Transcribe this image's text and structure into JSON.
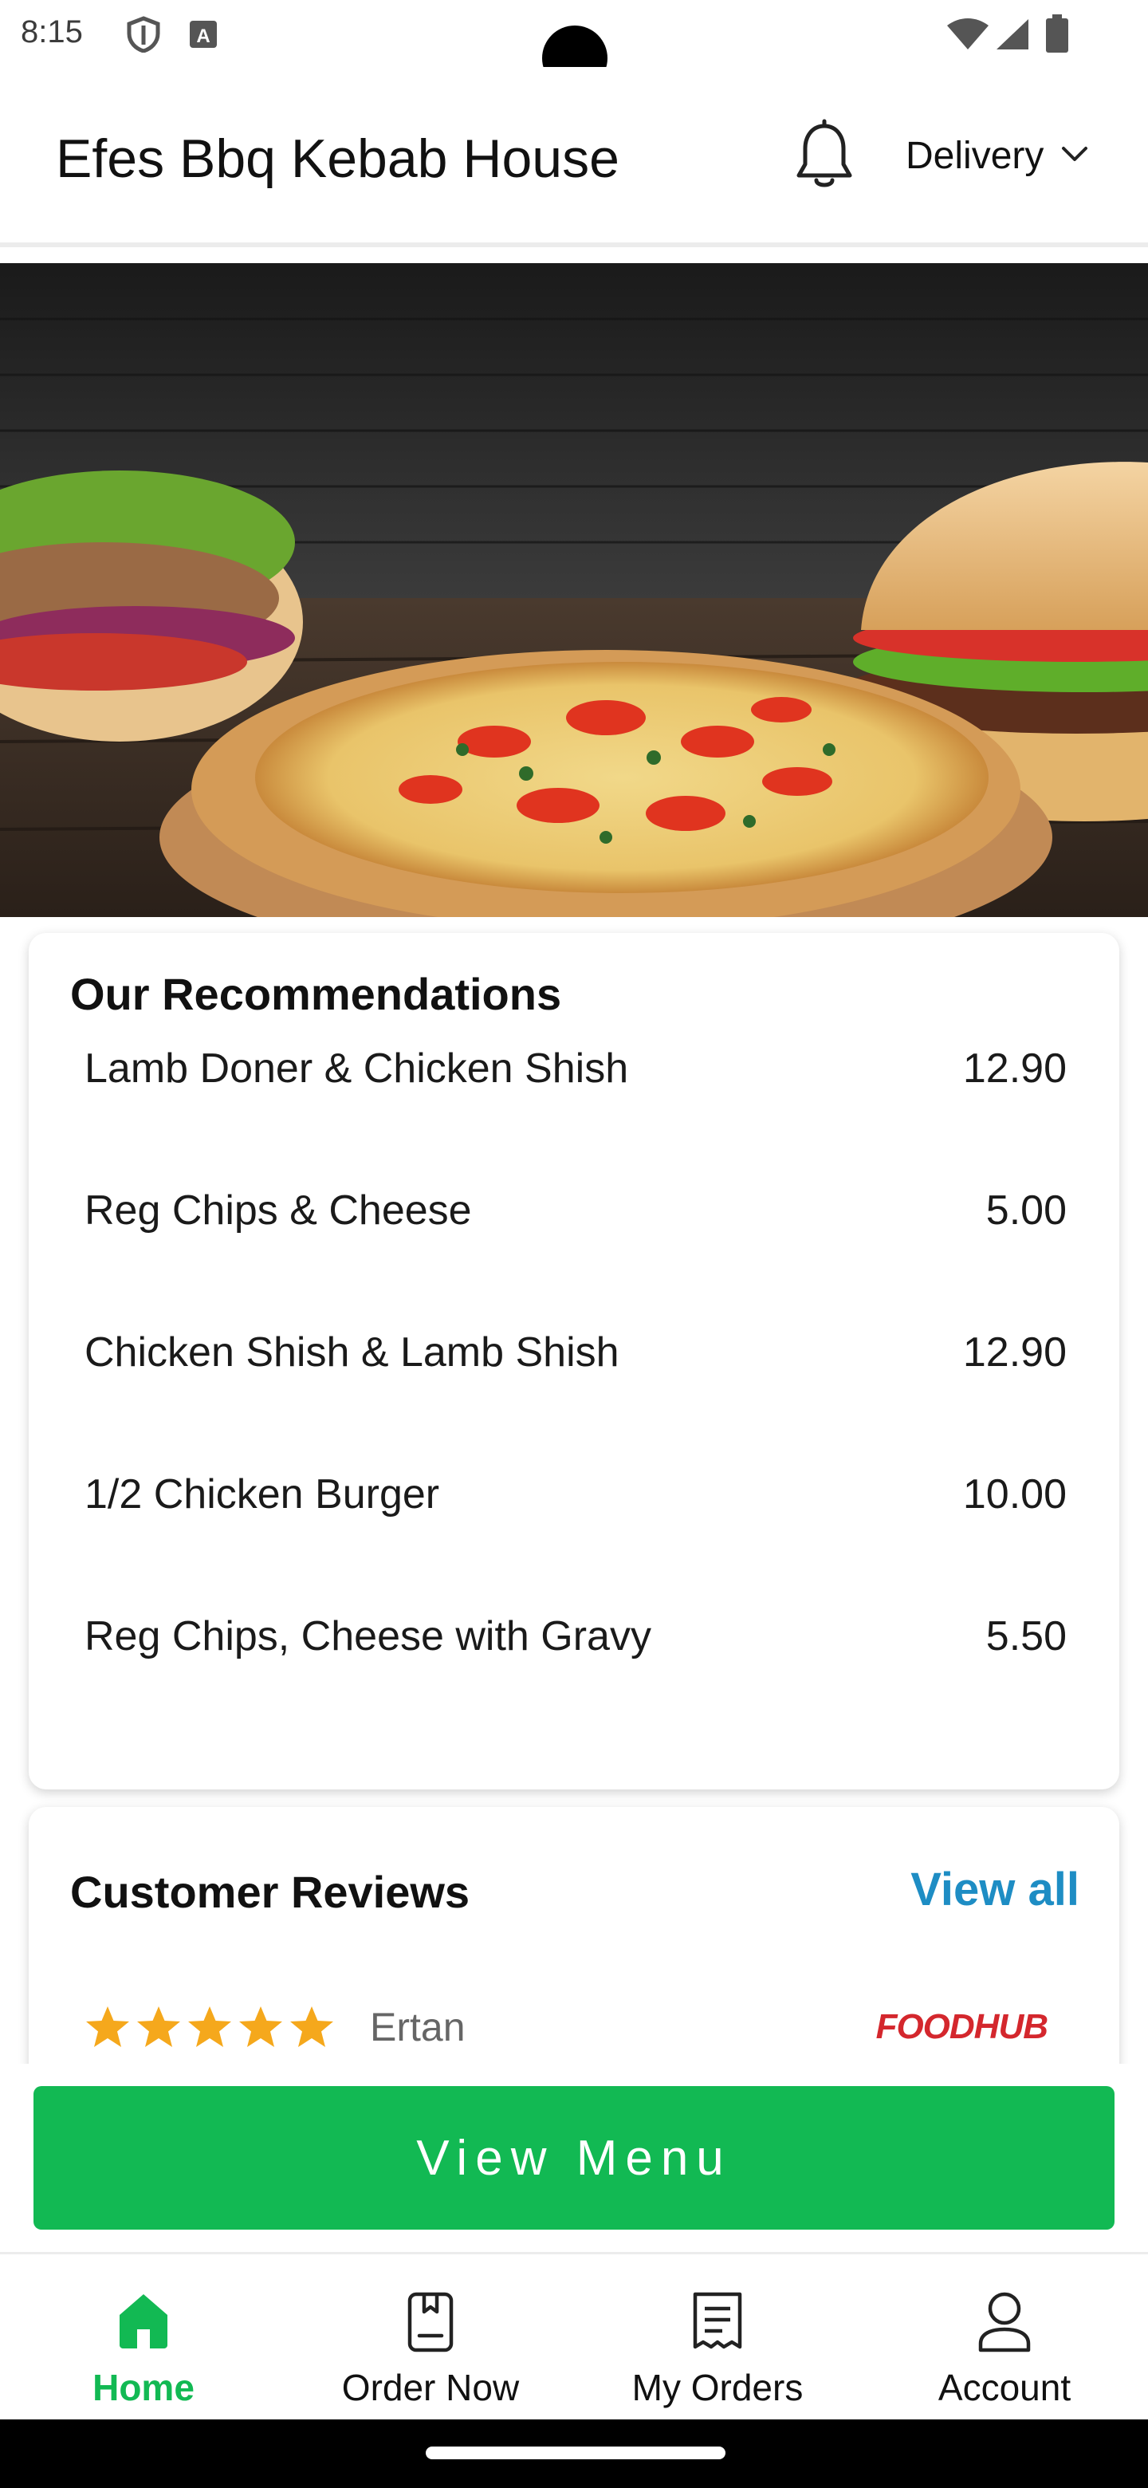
{
  "status_bar": {
    "time": "8:15",
    "icons": [
      "shield-icon",
      "text-a-icon",
      "wifi-icon",
      "signal-icon",
      "battery-icon"
    ]
  },
  "header": {
    "store_name": "Efes Bbq Kebab House",
    "notification_icon": "bell-icon",
    "order_mode": "Delivery"
  },
  "hero": {
    "image": "food-banner: doner kebab, pizza, burger on dark wood"
  },
  "recommendations": {
    "title": "Our Recommendations",
    "items": [
      {
        "name": "Lamb Doner & Chicken Shish",
        "price": "12.90"
      },
      {
        "name": "Reg Chips & Cheese",
        "price": "5.00"
      },
      {
        "name": "Chicken Shish & Lamb Shish",
        "price": "12.90"
      },
      {
        "name": "1/2 Chicken Burger",
        "price": "10.00"
      },
      {
        "name": "Reg Chips, Cheese with Gravy",
        "price": "5.50"
      }
    ]
  },
  "reviews": {
    "title": "Customer Reviews",
    "view_all": "View all",
    "items": [
      {
        "reviewer": "Ertan",
        "rating": 5,
        "source": "FOODHUB"
      }
    ]
  },
  "cta": {
    "label": "View Menu"
  },
  "bottom_nav": {
    "items": [
      {
        "label": "Home",
        "icon": "home-icon",
        "active": true
      },
      {
        "label": "Order Now",
        "icon": "order-book-icon",
        "active": false
      },
      {
        "label": "My Orders",
        "icon": "receipt-icon",
        "active": false
      },
      {
        "label": "Account",
        "icon": "user-icon",
        "active": false
      }
    ]
  },
  "colors": {
    "accent_green": "#12b953",
    "link_blue": "#1e8dc4",
    "star": "#f5a81c",
    "brand_red": "#d4272d"
  }
}
